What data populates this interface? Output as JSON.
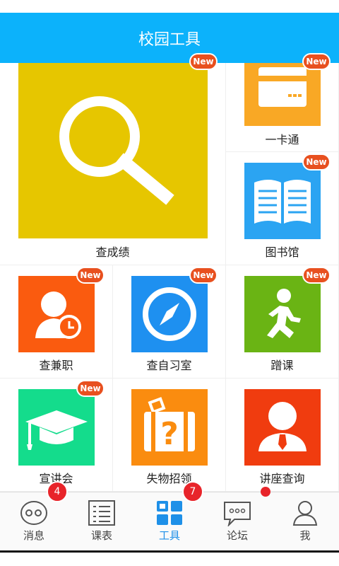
{
  "header": {
    "title": "校园工具"
  },
  "tools": [
    {
      "label": "查成绩",
      "icon": "search-icon",
      "color": "#e6c600",
      "badge": "New"
    },
    {
      "label": "一卡通",
      "icon": "card-icon",
      "color": "#f9a825",
      "badge": "New"
    },
    {
      "label": "图书馆",
      "icon": "book-icon",
      "color": "#2ba4f2",
      "badge": "New"
    },
    {
      "label": "查兼职",
      "icon": "person-clock-icon",
      "color": "#fa5b0f",
      "badge": "New"
    },
    {
      "label": "查自习室",
      "icon": "compass-icon",
      "color": "#1e90f0",
      "badge": "New"
    },
    {
      "label": "蹭课",
      "icon": "running-man-icon",
      "color": "#6ab414",
      "badge": "New"
    },
    {
      "label": "宣讲会",
      "icon": "graduation-cap-icon",
      "color": "#14dc8c",
      "badge": "New"
    },
    {
      "label": "失物招领",
      "icon": "lost-luggage-icon",
      "color": "#fa8c0f",
      "badge": ""
    },
    {
      "label": "讲座查询",
      "icon": "lecturer-icon",
      "color": "#f03c0f",
      "badge": ""
    }
  ],
  "tabs": [
    {
      "label": "消息",
      "icon": "chat-face-icon",
      "badge": "4",
      "active": false
    },
    {
      "label": "课表",
      "icon": "schedule-icon",
      "badge": "",
      "active": false
    },
    {
      "label": "工具",
      "icon": "grid-icon",
      "badge": "7",
      "active": true
    },
    {
      "label": "论坛",
      "icon": "forum-icon",
      "badge": "",
      "active": false
    },
    {
      "label": "我",
      "icon": "profile-icon",
      "badge": "",
      "active": false
    }
  ],
  "colors": {
    "accent": "#0cb2fb",
    "active_tab": "#1e90e8",
    "badge_red": "#e8242a",
    "new_badge": "#e8501f"
  }
}
